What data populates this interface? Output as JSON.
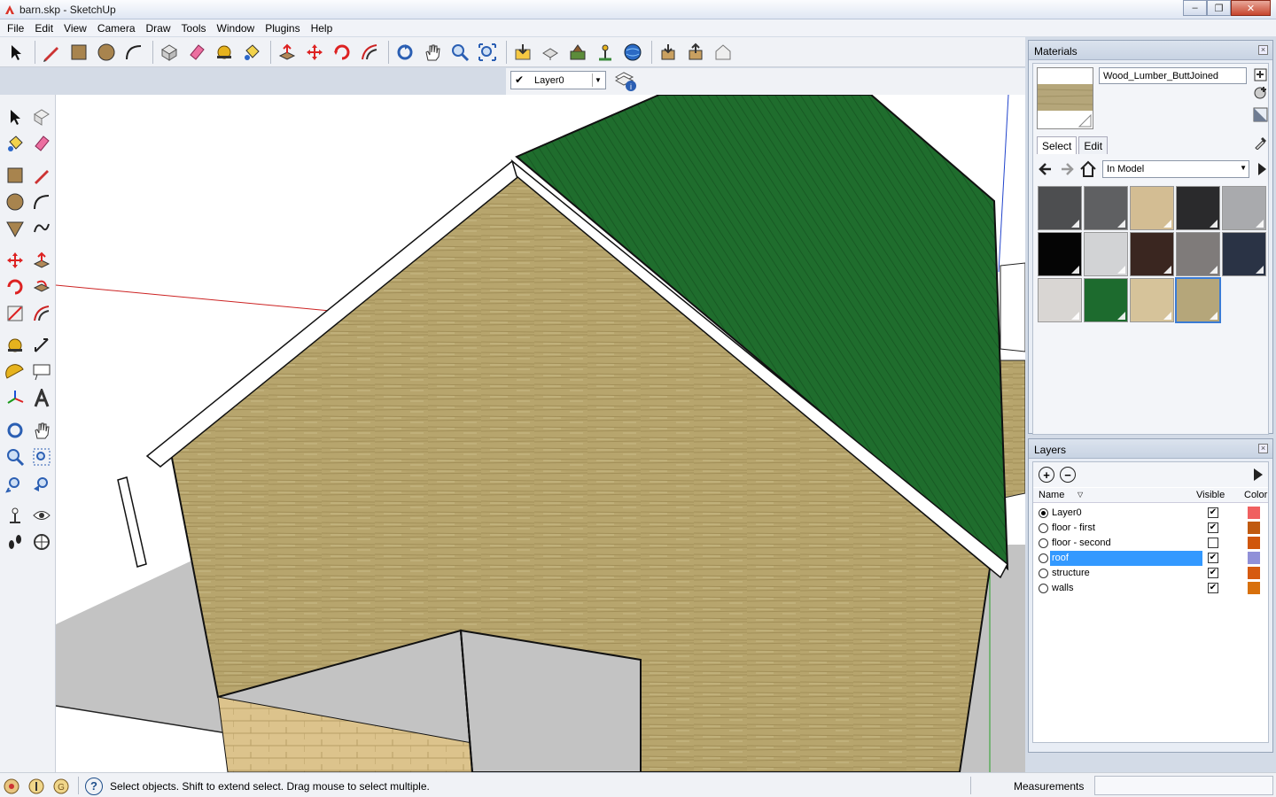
{
  "window": {
    "title": "barn.skp - SketchUp",
    "minimize": "‒",
    "maximize": "❐",
    "close": "✕"
  },
  "menu": [
    "File",
    "Edit",
    "View",
    "Camera",
    "Draw",
    "Tools",
    "Window",
    "Plugins",
    "Help"
  ],
  "layer_toolbar": {
    "current_layer": "Layer0"
  },
  "materials_panel": {
    "title": "Materials",
    "material_name": "Wood_Lumber_ButtJoined",
    "tabs": [
      "Select",
      "Edit"
    ],
    "collection": "In Model",
    "swatch_colors": [
      "#4d4e50",
      "#5f6062",
      "#d3bd93",
      "#2a2a2c",
      "#a9aaad",
      "#050505",
      "#d2d3d5",
      "#3a2620",
      "#7f7b7a",
      "#2a3345",
      "#d9d6d3",
      "#1d6b2e",
      "#d6c39a",
      "#b5a67a"
    ]
  },
  "layers_panel": {
    "title": "Layers",
    "columns": {
      "name": "Name",
      "visible": "Visible",
      "color": "Color"
    },
    "rows": [
      {
        "name": "Layer0",
        "active": true,
        "visible": true,
        "color": "#f06060",
        "selected": false
      },
      {
        "name": "floor - first",
        "active": false,
        "visible": true,
        "color": "#c05a10",
        "selected": false
      },
      {
        "name": "floor - second",
        "active": false,
        "visible": false,
        "color": "#d0560c",
        "selected": false
      },
      {
        "name": "roof",
        "active": false,
        "visible": true,
        "color": "#9090d8",
        "selected": true
      },
      {
        "name": "structure",
        "active": false,
        "visible": true,
        "color": "#d65a10",
        "selected": false
      },
      {
        "name": "walls",
        "active": false,
        "visible": true,
        "color": "#d8700c",
        "selected": false
      }
    ]
  },
  "status": {
    "hint": "Select objects. Shift to extend select. Drag mouse to select multiple.",
    "measurements_label": "Measurements",
    "help_glyph": "?"
  }
}
